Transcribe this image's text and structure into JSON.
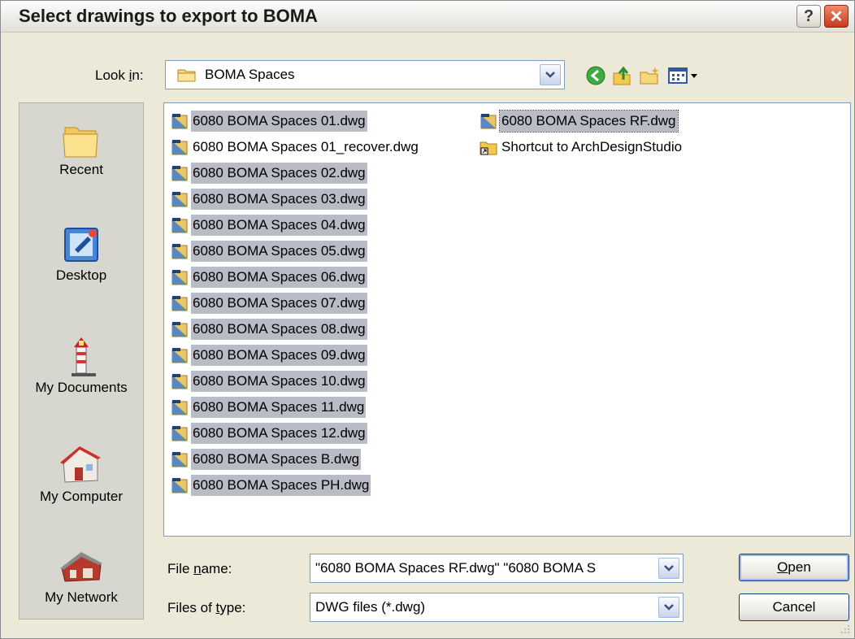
{
  "window": {
    "title": "Select drawings to export to BOMA",
    "help_label": "?",
    "close_label": "✕"
  },
  "lookin": {
    "label_pre": "Look ",
    "label_acc": "i",
    "label_post": "n:",
    "value": "BOMA Spaces"
  },
  "toolbar": {
    "icons": [
      "back-icon",
      "up-folder-icon",
      "new-folder-icon",
      "view-menu-icon"
    ]
  },
  "places": [
    {
      "label": "Recent",
      "icon": "recent-folder-icon"
    },
    {
      "label": "Desktop",
      "icon": "desktop-icon"
    },
    {
      "label": "My Documents",
      "icon": "my-documents-icon"
    },
    {
      "label": "My Computer",
      "icon": "my-computer-icon"
    },
    {
      "label": "My Network",
      "icon": "my-network-icon"
    }
  ],
  "files": [
    {
      "name": "6080 BOMA Spaces 01.dwg",
      "selected": true,
      "icon": "dwg-file-icon"
    },
    {
      "name": "6080 BOMA Spaces 01_recover.dwg",
      "selected": false,
      "icon": "dwg-file-icon"
    },
    {
      "name": "6080 BOMA Spaces 02.dwg",
      "selected": true,
      "icon": "dwg-file-icon"
    },
    {
      "name": "6080 BOMA Spaces 03.dwg",
      "selected": true,
      "icon": "dwg-file-icon"
    },
    {
      "name": "6080 BOMA Spaces 04.dwg",
      "selected": true,
      "icon": "dwg-file-icon"
    },
    {
      "name": "6080 BOMA Spaces 05.dwg",
      "selected": true,
      "icon": "dwg-file-icon"
    },
    {
      "name": "6080 BOMA Spaces 06.dwg",
      "selected": true,
      "icon": "dwg-file-icon"
    },
    {
      "name": "6080 BOMA Spaces 07.dwg",
      "selected": true,
      "icon": "dwg-file-icon"
    },
    {
      "name": "6080 BOMA Spaces 08.dwg",
      "selected": true,
      "icon": "dwg-file-icon"
    },
    {
      "name": "6080 BOMA Spaces 09.dwg",
      "selected": true,
      "icon": "dwg-file-icon"
    },
    {
      "name": "6080 BOMA Spaces 10.dwg",
      "selected": true,
      "icon": "dwg-file-icon"
    },
    {
      "name": "6080 BOMA Spaces 11.dwg",
      "selected": true,
      "icon": "dwg-file-icon"
    },
    {
      "name": "6080 BOMA Spaces 12.dwg",
      "selected": true,
      "icon": "dwg-file-icon"
    },
    {
      "name": "6080 BOMA Spaces B.dwg",
      "selected": true,
      "icon": "dwg-file-icon"
    },
    {
      "name": "6080 BOMA Spaces PH.dwg",
      "selected": true,
      "icon": "dwg-file-icon"
    },
    {
      "name": "6080 BOMA Spaces RF.dwg",
      "selected": true,
      "icon": "dwg-file-icon"
    },
    {
      "name": "Shortcut to ArchDesignStudio",
      "selected": false,
      "icon": "folder-shortcut-icon"
    }
  ],
  "filename": {
    "label_pre": "File ",
    "label_acc": "n",
    "label_post": "ame:",
    "value": "\"6080 BOMA Spaces RF.dwg\" \"6080 BOMA S"
  },
  "filetype": {
    "label_pre": "Files of ",
    "label_acc": "t",
    "label_post": "ype:",
    "value": "DWG files (*.dwg)"
  },
  "buttons": {
    "open_acc": "O",
    "open_rest": "pen",
    "cancel": "Cancel"
  },
  "colors": {
    "dialog_bg": "#ece9d8",
    "selection_bg": "#b9bbc6",
    "close_button": "#c6391b"
  }
}
